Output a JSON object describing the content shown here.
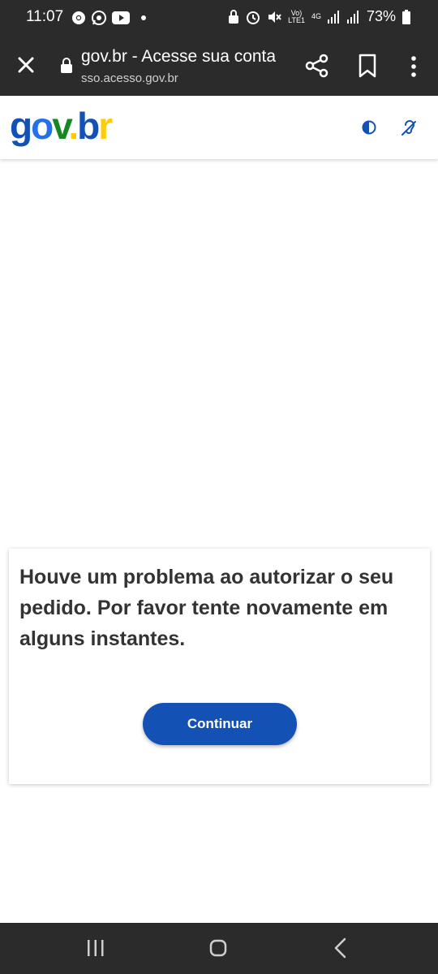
{
  "status_bar": {
    "time": "11:07",
    "network_top": "Vo)",
    "network_bottom": "LTE1",
    "net_type": "4G",
    "battery": "73%",
    "icons": [
      "chrome-icon",
      "whatsapp-icon",
      "youtube-icon",
      "notification-dot",
      "lock-screen-icon",
      "alarm-icon",
      "mute-icon",
      "signal-icon",
      "battery-icon"
    ]
  },
  "browser": {
    "title": "gov.br - Acesse sua conta",
    "url": "sso.acesso.gov.br"
  },
  "header": {
    "logo": {
      "g": "g",
      "o": "o",
      "v": "v",
      "dot": ".",
      "b": "b",
      "r": "r"
    }
  },
  "card": {
    "message": "Houve um problema ao autorizar o seu pedido. Por favor tente novamente em alguns instantes.",
    "button_label": "Continuar"
  },
  "colors": {
    "primary": "#1351b4",
    "system_bar": "#2b2b2b",
    "text": "#333333"
  }
}
